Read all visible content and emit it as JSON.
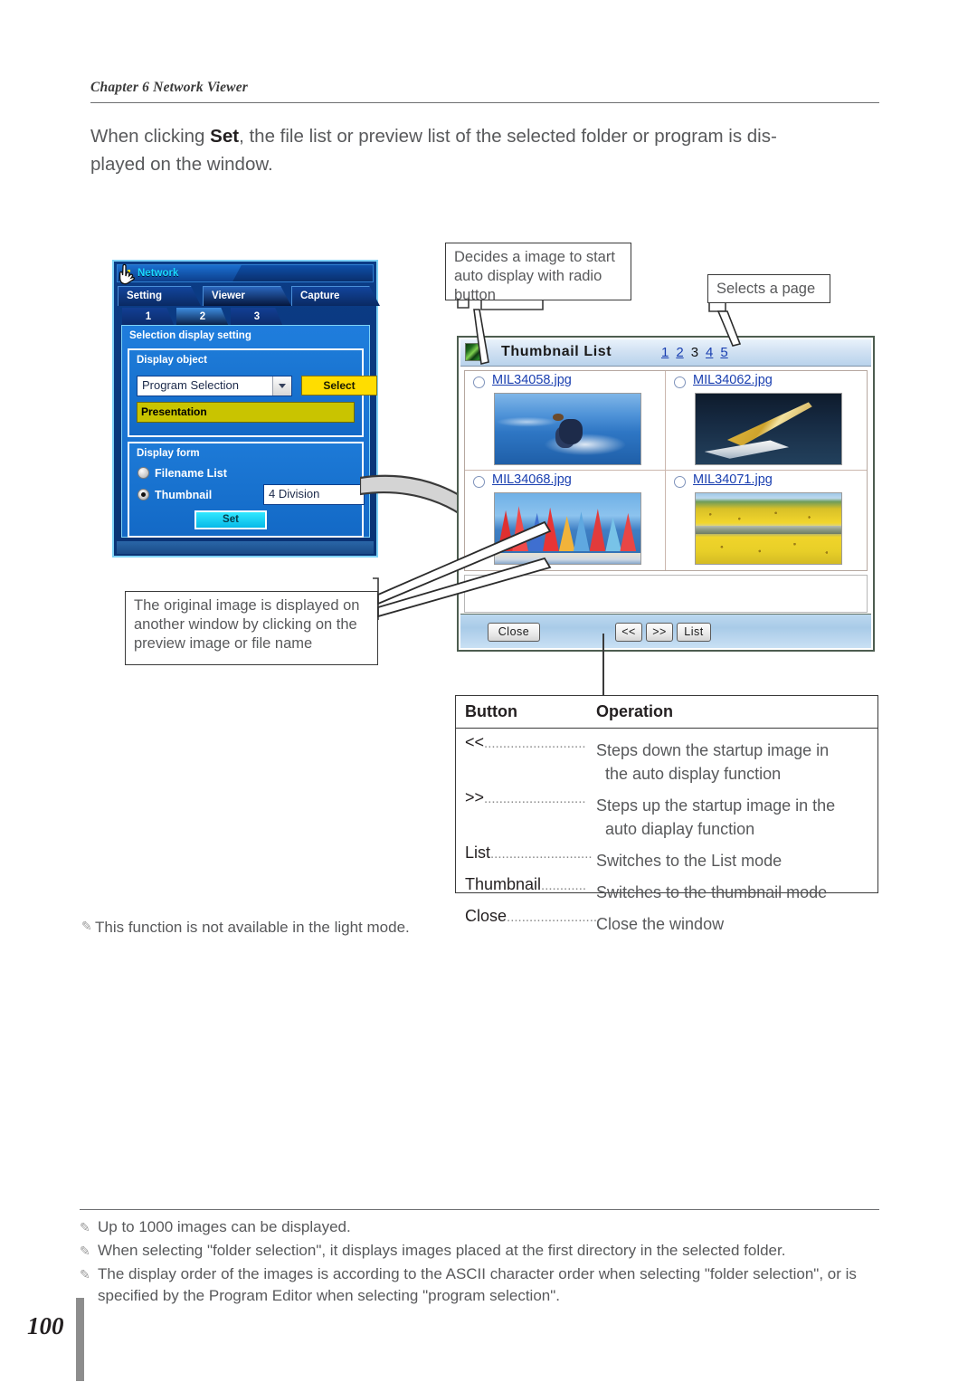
{
  "page": {
    "chapter_header": "Chapter 6 Network Viewer",
    "page_number": "100",
    "intro_line1_pre": "When clicking ",
    "intro_bold": "Set",
    "intro_line1_post": ", the file list or preview list of the selected folder or program is dis-",
    "intro_line2": "played on the window."
  },
  "network_dialog": {
    "title": "Network",
    "title_icon": "grid-dots-icon",
    "main_tabs": [
      {
        "label": "Setting",
        "active": false
      },
      {
        "label": "Viewer",
        "active": true
      },
      {
        "label": "Capture",
        "active": false
      }
    ],
    "sub_tabs": [
      {
        "label": "1",
        "active": false
      },
      {
        "label": "2",
        "active": true
      },
      {
        "label": "3",
        "active": false
      }
    ],
    "section_title": "Selection display setting",
    "display_object": {
      "group_label": "Display object",
      "combo_value": "Program Selection",
      "combo_arrow_icon": "chevron-down-icon",
      "select_button": "Select",
      "list_selected_item": "Presentation"
    },
    "display_form": {
      "group_label": "Display form",
      "radios": [
        {
          "label": "Filename List",
          "checked": false
        },
        {
          "label": "Thumbnail",
          "checked": true
        }
      ],
      "division_value": "4 Division",
      "set_button": "Set"
    },
    "cursor_icon": "pointing-hand-cursor"
  },
  "thumbnail_window": {
    "title": "Thumbnail List",
    "title_icon": "image-thumbnail-icon",
    "pages": [
      {
        "label": "1",
        "current": false
      },
      {
        "label": "2",
        "current": false
      },
      {
        "label": "3",
        "current": true
      },
      {
        "label": "4",
        "current": false
      },
      {
        "label": "5",
        "current": false
      }
    ],
    "items": [
      {
        "filename": "MIL34058.jpg",
        "radio_selected": false,
        "image": "water-skier-photo"
      },
      {
        "filename": "MIL34062.jpg",
        "radio_selected": false,
        "image": "yellow-sailboat-photo"
      },
      {
        "filename": "MIL34068.jpg",
        "radio_selected": false,
        "image": "windsurfers-photo"
      },
      {
        "filename": "MIL34071.jpg",
        "radio_selected": false,
        "image": "sunflower-field-photo"
      }
    ],
    "toolbar": {
      "close": "Close",
      "prev": "<<",
      "next": ">>",
      "list": "List"
    }
  },
  "callouts": {
    "radio_button": "Decides a image to start auto display with radio button",
    "selects_page": "Selects a page",
    "original_image": "The original image is displayed on another window by clicking on the preview image or file name"
  },
  "operation_table": {
    "header": {
      "button": "Button",
      "operation": "Operation"
    },
    "rows": [
      {
        "button": "<<",
        "dots": "...........................",
        "desc": "Steps down the startup image in",
        "cont": "the auto display function"
      },
      {
        "button": ">>",
        "dots": "...........................",
        "desc": "Steps up the startup image in the",
        "cont": "auto diaplay function"
      },
      {
        "button": "List",
        "dots": "...........................",
        "desc": "Switches to the List mode",
        "cont": ""
      },
      {
        "button": "Thumbnail",
        "dots": "............",
        "desc": "Switches to the thumbnail mode",
        "cont": ""
      },
      {
        "button": "Close",
        "dots": "........................",
        "desc": "Close the window",
        "cont": ""
      }
    ]
  },
  "notes": {
    "light_mode": "This function is not available in the light mode.",
    "bottom": [
      "Up to 1000 images can be displayed.",
      "When selecting \"folder selection\", it displays images placed at the first directory in the selected folder.",
      "The display order of the images is according to the ASCII character order when selecting \"folder selection\", or is specified by the Program Editor when selecting \"program selection\"."
    ]
  },
  "colors": {
    "accent_blue": "#1a3fb0",
    "dialog_blue": "#1973d2",
    "yellow_button": "#ffdd00",
    "olive_list": "#c9c400",
    "text_gray": "#58595b"
  }
}
